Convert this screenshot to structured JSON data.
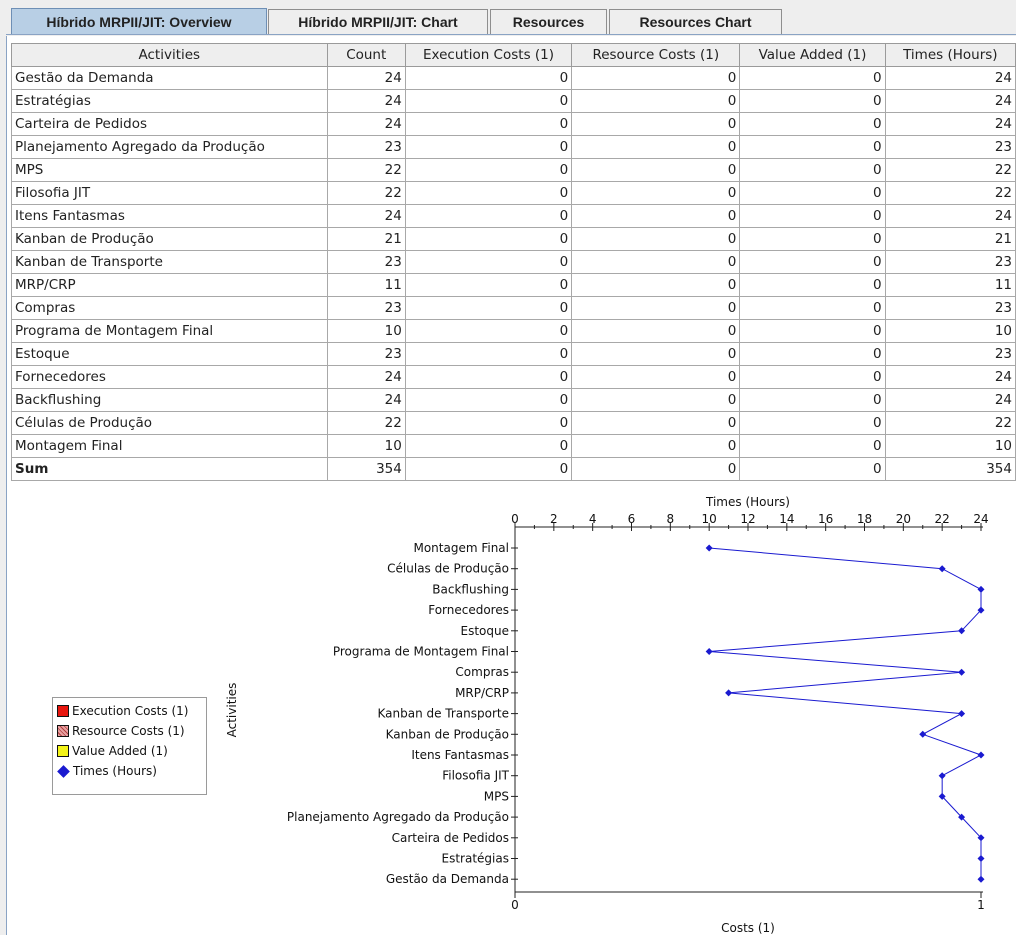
{
  "tabs": [
    {
      "label": "Híbrido MRPII/JIT: Overview",
      "active": true
    },
    {
      "label": "Híbrido MRPII/JIT: Chart",
      "active": false
    },
    {
      "label": "Resources",
      "active": false
    },
    {
      "label": "Resources Chart",
      "active": false
    }
  ],
  "table": {
    "columns": [
      "Activities",
      "Count",
      "Execution Costs (1)",
      "Resource Costs (1)",
      "Value Added (1)",
      "Times (Hours)"
    ],
    "rows": [
      [
        "Gestão da Demanda",
        "24",
        "0",
        "0",
        "0",
        "24"
      ],
      [
        "Estratégias",
        "24",
        "0",
        "0",
        "0",
        "24"
      ],
      [
        "Carteira de Pedidos",
        "24",
        "0",
        "0",
        "0",
        "24"
      ],
      [
        "Planejamento Agregado da Produção",
        "23",
        "0",
        "0",
        "0",
        "23"
      ],
      [
        "MPS",
        "22",
        "0",
        "0",
        "0",
        "22"
      ],
      [
        "Filosofia JIT",
        "22",
        "0",
        "0",
        "0",
        "22"
      ],
      [
        "Itens Fantasmas",
        "24",
        "0",
        "0",
        "0",
        "24"
      ],
      [
        "Kanban de Produção",
        "21",
        "0",
        "0",
        "0",
        "21"
      ],
      [
        "Kanban de Transporte",
        "23",
        "0",
        "0",
        "0",
        "23"
      ],
      [
        "MRP/CRP",
        "11",
        "0",
        "0",
        "0",
        "11"
      ],
      [
        "Compras",
        "23",
        "0",
        "0",
        "0",
        "23"
      ],
      [
        "Programa de Montagem Final",
        "10",
        "0",
        "0",
        "0",
        "10"
      ],
      [
        "Estoque",
        "23",
        "0",
        "0",
        "0",
        "23"
      ],
      [
        "Fornecedores",
        "24",
        "0",
        "0",
        "0",
        "24"
      ],
      [
        "Backflushing",
        "24",
        "0",
        "0",
        "0",
        "24"
      ],
      [
        "Células de Produção",
        "22",
        "0",
        "0",
        "0",
        "22"
      ],
      [
        "Montagem Final",
        "10",
        "0",
        "0",
        "0",
        "10"
      ]
    ],
    "sum": [
      "Sum",
      "354",
      "0",
      "0",
      "0",
      "354"
    ]
  },
  "legend": [
    {
      "label": "Execution Costs (1)",
      "color": "#e8160e",
      "shape": "square"
    },
    {
      "label": "Resource Costs (1)",
      "color": "#c86060",
      "shape": "hatched-square"
    },
    {
      "label": "Value Added (1)",
      "color": "#f4f418",
      "shape": "square"
    },
    {
      "label": "Times (Hours)",
      "color": "#1a1ad0",
      "shape": "diamond"
    }
  ],
  "chart_data": {
    "type": "line",
    "orientation": "horizontal",
    "top_axis_label": "Times (Hours)",
    "bottom_axis_label": "Costs (1)",
    "y_axis_label": "Activities",
    "top_ticks": [
      "0",
      "2",
      "4",
      "6",
      "8",
      "10",
      "12",
      "14",
      "16",
      "18",
      "20",
      "22",
      "24"
    ],
    "top_range": [
      0,
      24
    ],
    "bottom_ticks": [
      "0",
      "1"
    ],
    "bottom_range": [
      0,
      1
    ],
    "categories": [
      "Montagem Final",
      "Células de Produção",
      "Backflushing",
      "Fornecedores",
      "Estoque",
      "Programa de Montagem Final",
      "Compras",
      "MRP/CRP",
      "Kanban de Transporte",
      "Kanban de Produção",
      "Itens Fantasmas",
      "Filosofia JIT",
      "MPS",
      "Planejamento Agregado da Produção",
      "Carteira de Pedidos",
      "Estratégias",
      "Gestão da Demanda"
    ],
    "series": [
      {
        "name": "Times (Hours)",
        "color": "#1a1ad0",
        "values": [
          10,
          22,
          24,
          24,
          23,
          10,
          23,
          11,
          23,
          21,
          24,
          22,
          22,
          23,
          24,
          24,
          24
        ]
      }
    ]
  }
}
